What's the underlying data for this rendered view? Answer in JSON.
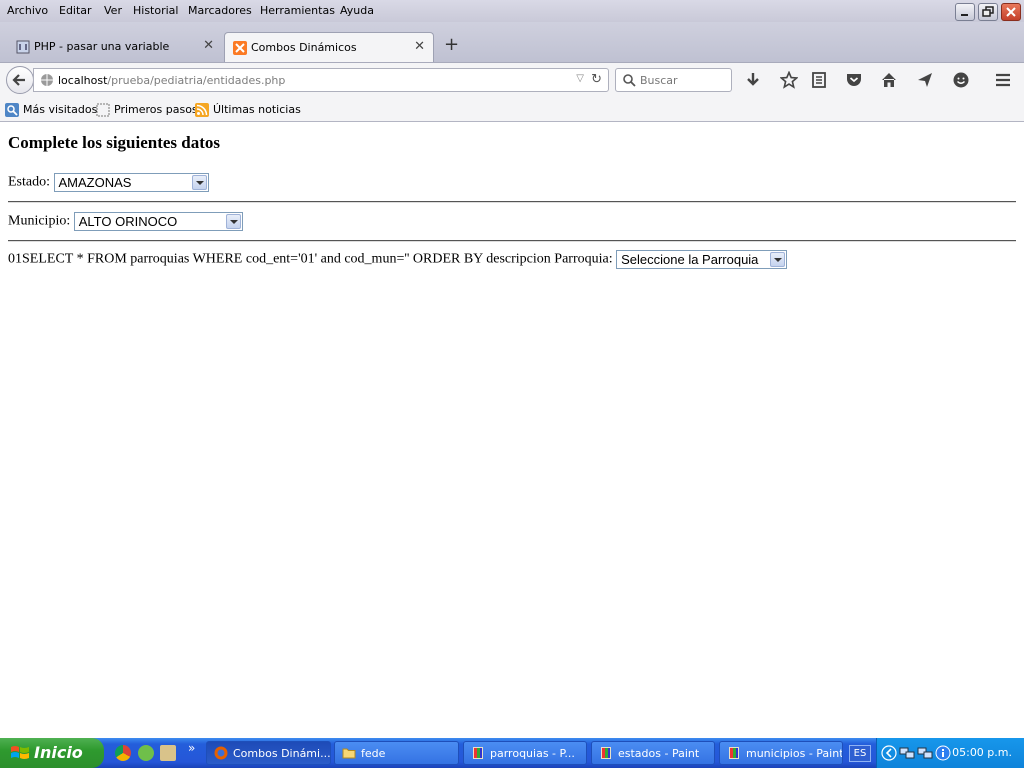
{
  "menubar": {
    "items": [
      "Archivo",
      "Editar",
      "Ver",
      "Historial",
      "Marcadores",
      "Herramientas",
      "Ayuda"
    ]
  },
  "tabs": [
    {
      "label": "PHP - pasar una variable",
      "active": false
    },
    {
      "label": "Combos Dinámicos",
      "active": true
    }
  ],
  "navbar": {
    "url_host": "localhost",
    "url_path": "/prueba/pediatria/entidades.php",
    "search_placeholder": "Buscar"
  },
  "bookmarks": [
    "Más visitados",
    "Primeros pasos",
    "Últimas noticias"
  ],
  "page": {
    "heading": "Complete los siguientes datos",
    "estado_label": "Estado:",
    "estado_value": "AMAZONAS",
    "municipio_label": "Municipio:",
    "municipio_value": "ALTO ORINOCO",
    "query_text": "01SELECT * FROM parroquias WHERE cod_ent='01' and cod_mun='' ORDER BY descripcion Parroquia:",
    "parroquia_value": "Seleccione la Parroquia"
  },
  "taskbar": {
    "start_label": "Inicio",
    "buttons": [
      {
        "label": "Combos Dinámi...",
        "icon": "firefox-icon",
        "active": true
      },
      {
        "label": "fede",
        "icon": "folder-icon",
        "active": false
      },
      {
        "label": "parroquias - P...",
        "icon": "paint-icon",
        "active": false
      },
      {
        "label": "estados - Paint",
        "icon": "paint-icon",
        "active": false
      },
      {
        "label": "municipios - Paint",
        "icon": "paint-icon",
        "active": false
      }
    ],
    "language": "ES",
    "clock": "05:00 p.m."
  },
  "colors": {
    "taskbar_blue": "#245edb",
    "start_green": "#2f9a2f",
    "tray_blue": "#0e83da"
  }
}
